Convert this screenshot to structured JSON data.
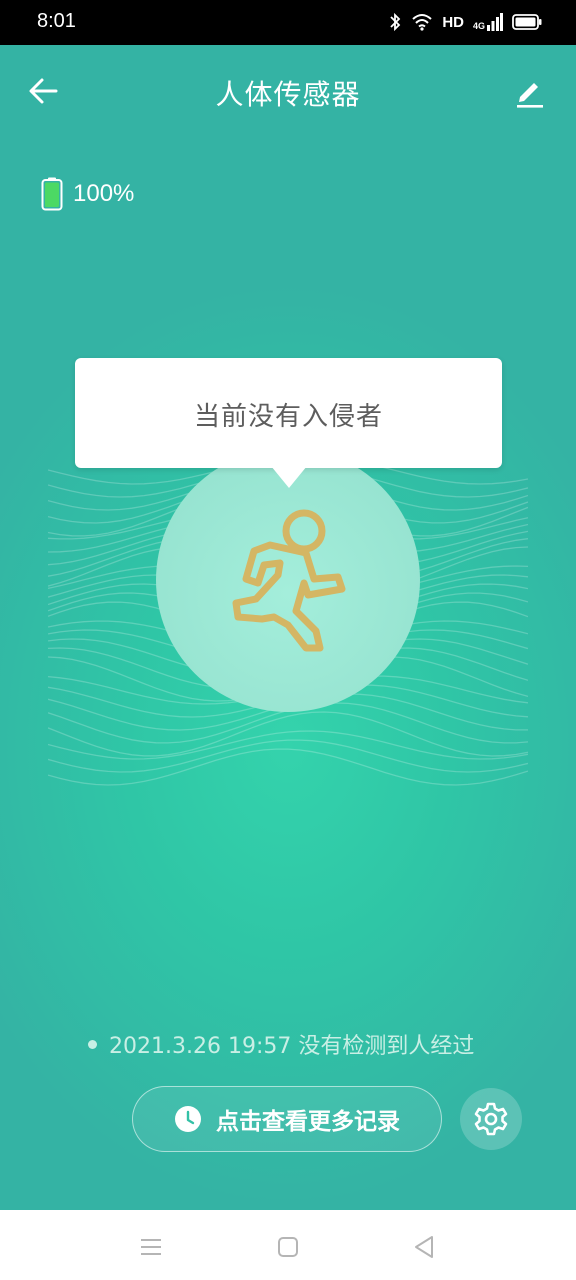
{
  "status_bar": {
    "time": "8:01",
    "hd_label": "HD",
    "network_label": "4G",
    "icons": [
      "bluetooth-icon",
      "wifi-icon",
      "signal-icon",
      "battery-icon"
    ]
  },
  "header": {
    "title": "人体传感器",
    "back_icon": "arrow-left-icon",
    "edit_icon": "pencil-icon"
  },
  "battery": {
    "percent_label": "100%",
    "level": 1.0,
    "color": "#4cd964"
  },
  "tooltip": {
    "text": "当前没有入侵者"
  },
  "sensor": {
    "icon": "running-person-icon",
    "icon_color": "#d4b664"
  },
  "last_record": {
    "text": "2021.3.26 19:57 没有检测到人经过"
  },
  "records_button": {
    "label": "点击查看更多记录",
    "icon": "clock-icon"
  },
  "settings_button": {
    "icon": "gear-icon"
  },
  "nav_bar": {
    "items": [
      "menu-icon",
      "home-square-icon",
      "back-triangle-icon"
    ]
  },
  "colors": {
    "accent": "#34d3ac",
    "background_edge": "#34b3a4"
  }
}
